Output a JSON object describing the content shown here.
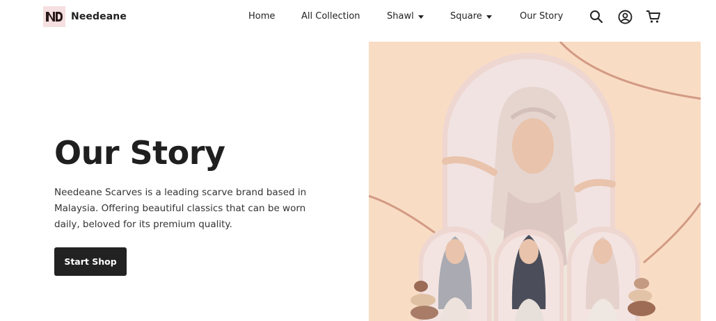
{
  "brand": {
    "name": "Needeane",
    "logo_icon": "needeane-monogram"
  },
  "nav": {
    "items": [
      {
        "label": "Home",
        "has_dropdown": false
      },
      {
        "label": "All Collection",
        "has_dropdown": false
      },
      {
        "label": "Shawl",
        "has_dropdown": true
      },
      {
        "label": "Square",
        "has_dropdown": true
      },
      {
        "label": "Our Story",
        "has_dropdown": false
      }
    ]
  },
  "header_icons": [
    "search-icon",
    "account-icon",
    "cart-icon"
  ],
  "hero": {
    "title": "Our Story",
    "description": "Needeane Scarves is a leading scarve brand based in Malaysia. Offering beautiful classics that can be worn daily, beloved for its premium quality.",
    "cta_label": "Start Shop"
  },
  "colors": {
    "text_dark": "#222222",
    "button_bg": "#222222",
    "hero_bg": "#f9dcc4",
    "arch": "#efd8d3",
    "curve": "#d29a84",
    "logo_bg": "#f6dfe0"
  }
}
